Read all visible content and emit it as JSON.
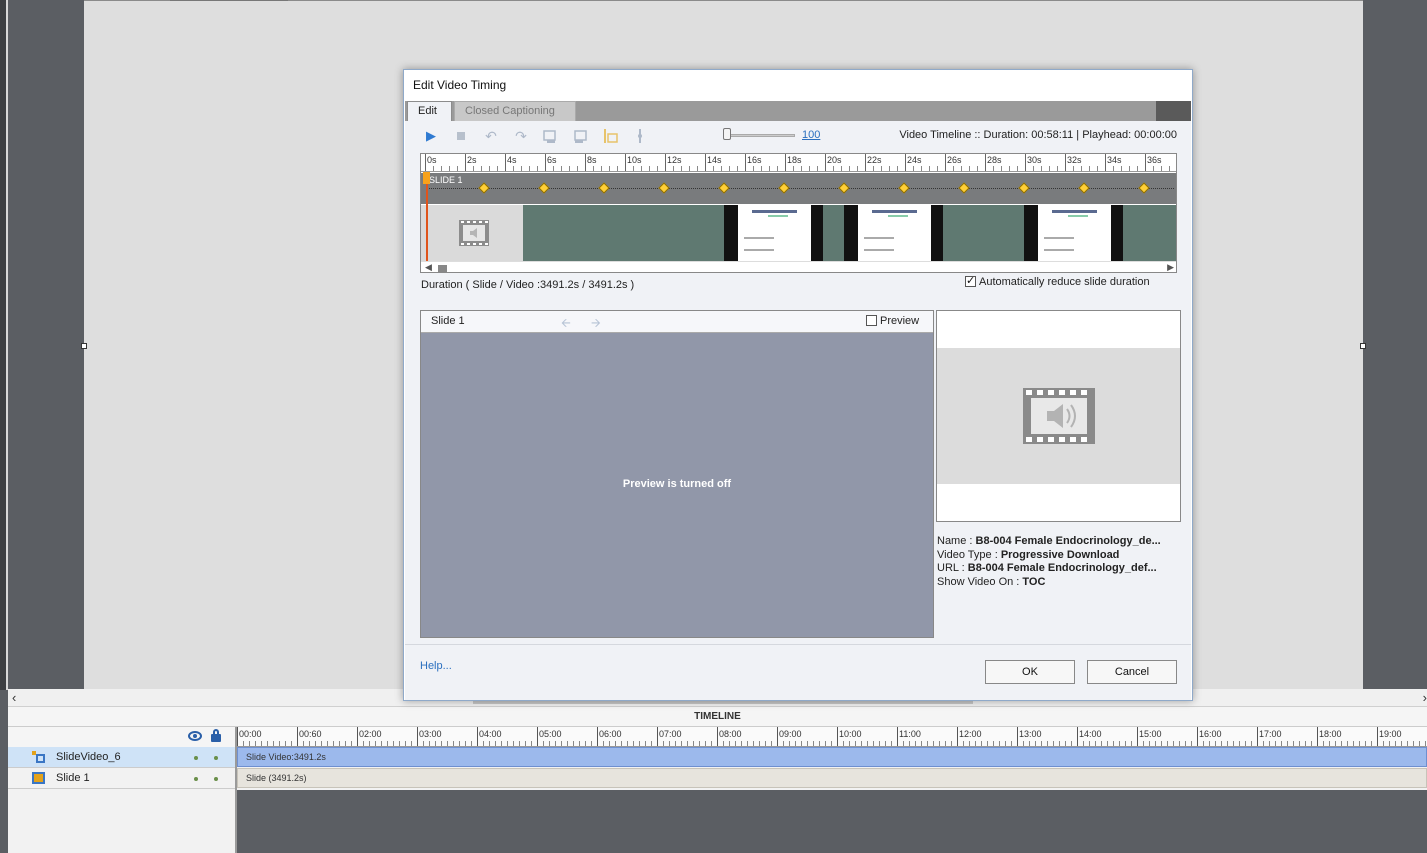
{
  "dialog": {
    "title": "Edit Video Timing",
    "tabs": [
      {
        "label": "Edit",
        "active": true
      },
      {
        "label": "Closed Captioning",
        "active": false
      }
    ],
    "zoom_value": "100",
    "timeline_info": "Video Timeline :: Duration: 00:58:11  |  Playhead: 00:00:00",
    "ruler_labels": [
      "0s",
      "2s",
      "4s",
      "6s",
      "8s",
      "10s",
      "12s",
      "14s",
      "16s",
      "18s",
      "20s",
      "22s",
      "24s",
      "26s",
      "28s",
      "30s",
      "32s",
      "34s",
      "36s"
    ],
    "slide_label": "SLIDE 1",
    "duration_text": "Duration ( Slide / Video   :3491.2s / 3491.2s )",
    "auto_reduce_label": "Automatically reduce slide duration",
    "auto_reduce_checked": true,
    "preview": {
      "slide_label": "Slide 1",
      "checkbox_label": "Preview",
      "off_message": "Preview is turned off"
    },
    "video_info": {
      "name_label": "Name  : ",
      "name_value": "B8-004 Female Endocrinology_de...",
      "type_label": "Video Type : ",
      "type_value": "Progressive Download",
      "url_label": "URL : ",
      "url_value": "B8-004 Female Endocrinology_def...",
      "show_label": "Show Video On : ",
      "show_value": "TOC"
    },
    "help_label": "Help...",
    "ok_label": "OK",
    "cancel_label": "Cancel"
  },
  "timeline": {
    "header": "TIMELINE",
    "ruler_labels": [
      "00:00",
      "00:60",
      "02:00",
      "03:00",
      "04:00",
      "05:00",
      "06:00",
      "07:00",
      "08:00",
      "09:00",
      "10:00",
      "11:00",
      "12:00",
      "13:00",
      "14:00",
      "15:00",
      "16:00",
      "17:00",
      "18:00",
      "19:00"
    ],
    "rows": [
      {
        "name": "SlideVideo_6",
        "bar_label": "Slide Video:3491.2s"
      },
      {
        "name": "Slide 1",
        "bar_label": "Slide (3491.2s)"
      }
    ]
  },
  "colors": {
    "accent": "#2f7ad1",
    "diamond": "#ffcf37",
    "playhead": "#e0541b",
    "video_bar": "#9cb9ec",
    "slide_bar": "#e7e4dd"
  }
}
